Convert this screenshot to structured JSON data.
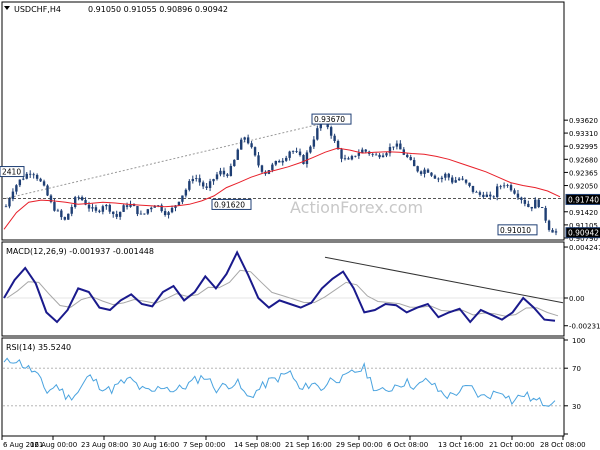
{
  "header": {
    "symbol": "USDCHF,H4",
    "ohlc": "0.91050 0.91055 0.90896 0.90942"
  },
  "watermark": "ActionForex.com",
  "colors": {
    "candle": "#1f3f74",
    "ma": "#e8202a",
    "macd": "#1a1a8c",
    "signal": "#a8a8a8",
    "rsi": "#4aa3df",
    "trend": "#333333",
    "grid_dash": "#999999"
  },
  "chart_data": [
    {
      "type": "line",
      "name": "price",
      "ylim": [
        0.9079,
        0.9641
      ],
      "yticks": [
        "0.93620",
        "0.93310",
        "0.92995",
        "0.92680",
        "0.92365",
        "0.92050",
        "0.91420",
        "0.91105",
        "0.90790"
      ],
      "annotations": [
        {
          "label": "0.93670",
          "value": 0.9367
        },
        {
          "label": "0.92410",
          "display": "2410",
          "value": 0.9241
        },
        {
          "label": "0.91620",
          "display": "0.91620",
          "value": 0.9162
        },
        {
          "label": "0.91010",
          "value": 0.9101
        }
      ],
      "horizontal_line": {
        "label": "0.91740",
        "value": 0.9174
      },
      "current_price": {
        "label": "0.90942",
        "value": 0.90942
      },
      "price_path": [
        0.9155,
        0.9195,
        0.9215,
        0.923,
        0.9241,
        0.9222,
        0.9195,
        0.916,
        0.914,
        0.9118,
        0.915,
        0.918,
        0.9168,
        0.915,
        0.914,
        0.916,
        0.915,
        0.9128,
        0.915,
        0.9162,
        0.9148,
        0.913,
        0.915,
        0.9162,
        0.915,
        0.9135,
        0.9155,
        0.9178,
        0.92,
        0.923,
        0.9212,
        0.9195,
        0.922,
        0.9238,
        0.923,
        0.925,
        0.93,
        0.9325,
        0.929,
        0.9255,
        0.9235,
        0.925,
        0.9262,
        0.9272,
        0.9292,
        0.928,
        0.9262,
        0.93,
        0.9335,
        0.9367,
        0.934,
        0.93,
        0.927,
        0.9262,
        0.928,
        0.929,
        0.9285,
        0.9275,
        0.9282,
        0.929,
        0.9305,
        0.929,
        0.9272,
        0.925,
        0.9238,
        0.9245,
        0.923,
        0.922,
        0.9232,
        0.9215,
        0.9222,
        0.921,
        0.9195,
        0.9182,
        0.9185,
        0.917,
        0.92,
        0.921,
        0.92,
        0.9185,
        0.9168,
        0.915,
        0.917,
        0.914,
        0.9101,
        0.90942
      ],
      "ma_path": [
        0.91,
        0.914,
        0.9165,
        0.917,
        0.9168,
        0.9165,
        0.916,
        0.9162,
        0.9165,
        0.9163,
        0.916,
        0.9158,
        0.9156,
        0.9154,
        0.9156,
        0.916,
        0.9168,
        0.918,
        0.92,
        0.9212,
        0.9225,
        0.9235,
        0.9242,
        0.925,
        0.926,
        0.9272,
        0.9285,
        0.9295,
        0.929,
        0.9283,
        0.9285,
        0.9286,
        0.9285,
        0.9282,
        0.928,
        0.9275,
        0.9268,
        0.9258,
        0.9248,
        0.9238,
        0.9225,
        0.9212,
        0.9205,
        0.92,
        0.9192,
        0.9178
      ],
      "trendline": {
        "from": 0.9174,
        "to": 0.9367,
        "style": "dashed"
      }
    },
    {
      "type": "line",
      "name": "MACD(12,26,9)",
      "label": "MACD(12,26,9) -0.001937 -0.001448",
      "ylim": [
        -0.003,
        0.0045
      ],
      "yticks": [
        "0.004247",
        "0.00",
        "-0.002311"
      ],
      "macd_path": [
        0.0,
        0.0015,
        0.0025,
        0.0012,
        -0.0012,
        -0.002,
        -0.001,
        0.0008,
        0.0005,
        -0.0008,
        -0.001,
        -0.0002,
        0.0003,
        -0.0005,
        -0.0007,
        0.0005,
        0.001,
        -0.0002,
        0.0005,
        0.0018,
        0.0008,
        0.002,
        0.0038,
        0.002,
        0.0,
        -0.0008,
        -0.0002,
        -0.0005,
        -0.0008,
        -0.0004,
        0.0008,
        0.0016,
        0.0022,
        0.0008,
        -0.0012,
        -0.001,
        -0.0005,
        -0.0006,
        -0.0012,
        -0.0008,
        -0.0005,
        -0.0016,
        -0.0012,
        -0.0009,
        -0.002,
        -0.001,
        -0.0014,
        -0.0018,
        -0.0012,
        0.0,
        -0.0008,
        -0.0018,
        -0.0019
      ],
      "trendline": {
        "style": "solid"
      }
    },
    {
      "type": "line",
      "name": "RSI(14)",
      "label": "RSI(14) 35.5240",
      "ylim": [
        0,
        100
      ],
      "yticks": [
        "100",
        "70",
        "30",
        "0"
      ],
      "rsi_path": [
        75,
        80,
        72,
        65,
        45,
        52,
        38,
        45,
        62,
        52,
        46,
        54,
        58,
        47,
        44,
        52,
        46,
        50,
        57,
        62,
        48,
        52,
        55,
        38,
        47,
        56,
        60,
        66,
        45,
        55,
        48,
        60,
        58,
        66,
        70,
        48,
        44,
        53,
        55,
        50,
        58,
        46,
        40,
        46,
        50,
        39,
        42,
        47,
        34,
        43,
        36,
        33,
        35.524
      ]
    }
  ],
  "x_axis": {
    "labels": [
      "6 Aug 2021",
      "16 Aug 00:00",
      "23 Aug 08:00",
      "30 Aug 16:00",
      "7 Sep 00:00",
      "14 Sep 08:00",
      "21 Sep 16:00",
      "29 Sep 00:00",
      "6 Oct 08:00",
      "13 Oct 16:00",
      "21 Oct 00:00",
      "28 Oct 08:00"
    ]
  }
}
